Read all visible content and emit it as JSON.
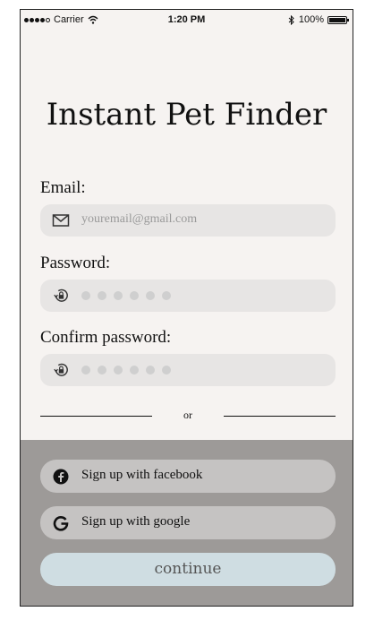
{
  "status_bar": {
    "carrier": "Carrier",
    "time": "1:20 PM",
    "battery": "100%"
  },
  "title": "Instant Pet Finder",
  "form": {
    "email_label": "Email:",
    "email_placeholder": "youremail@gmail.com",
    "password_label": "Password:",
    "confirm_label": "Confirm password:"
  },
  "divider_text": "or",
  "social": {
    "facebook_label": "Sign up with facebook",
    "google_label": "Sign up with google"
  },
  "continue_label": "continue",
  "colors": {
    "background": "#f6f3f1",
    "field": "#e7e5e4",
    "bottom_panel": "#9d9a98",
    "social_button": "#c5c3c2",
    "continue_button": "#cfdde2"
  }
}
